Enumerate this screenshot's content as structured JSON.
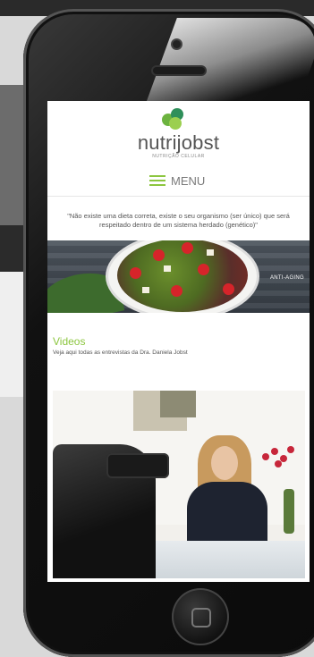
{
  "site": {
    "brand": "nutrijobst",
    "tagline": "NUTRIÇÃO CELULAR",
    "menu_label": "MENU"
  },
  "quote": "\"Não existe uma dieta correta, existe o seu organismo (ser único) que será respeitado dentro de um sistema herdado (genético)\"",
  "banner": {
    "label": "ANTI-AGING"
  },
  "videos": {
    "title": "Videos",
    "subtitle": "Veja aqui todas as entrevistas da Dra. Daniela Jobst"
  },
  "colors": {
    "accent": "#8cc63f",
    "brand_dark": "#2f8f5a"
  },
  "icons": {
    "menu": "hamburger-icon",
    "home": "home-button"
  }
}
